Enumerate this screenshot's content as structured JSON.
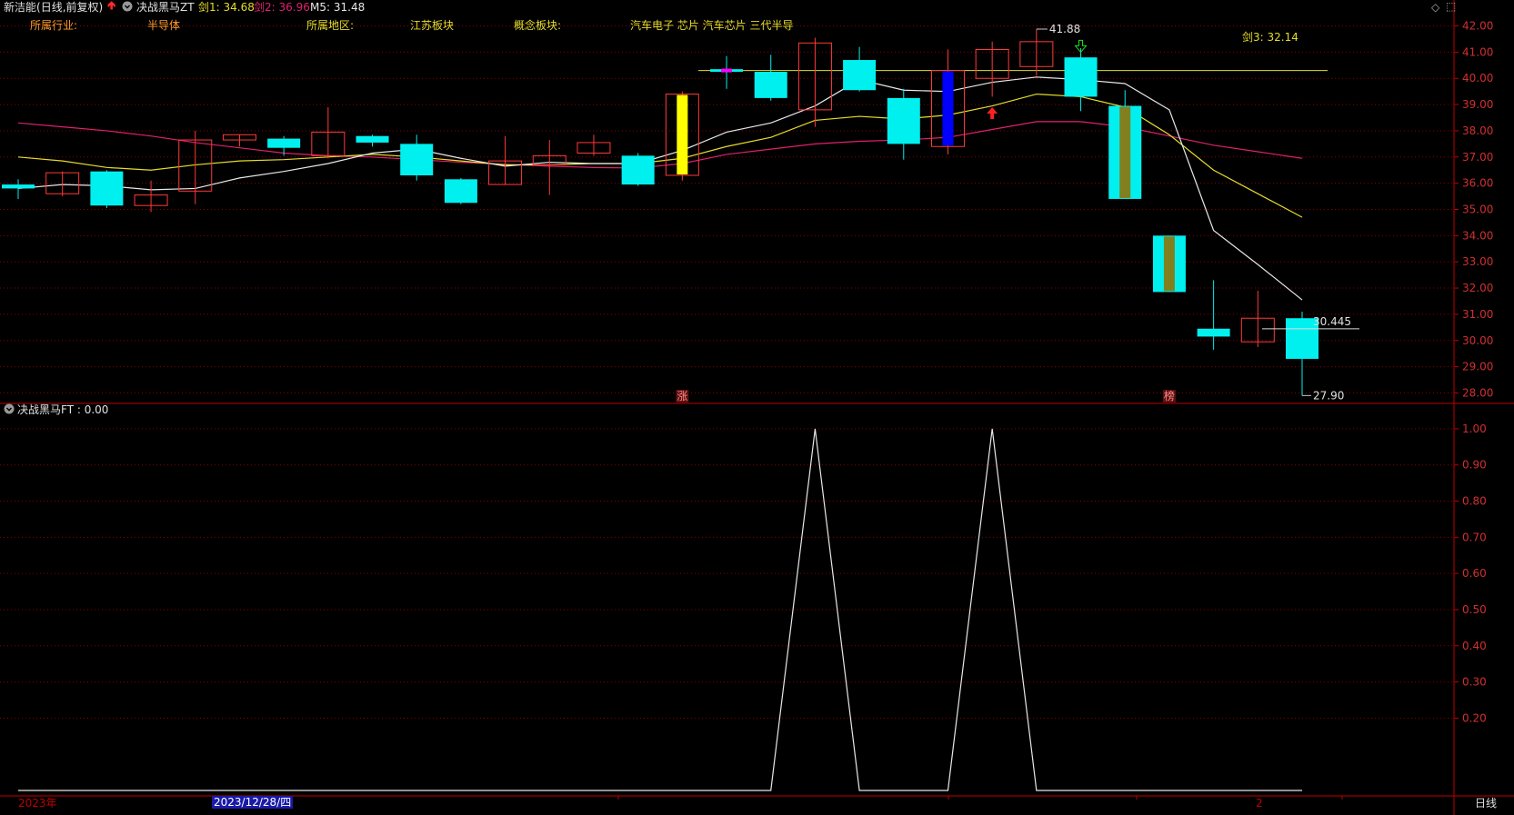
{
  "header": {
    "stock_name": "新洁能",
    "period_label": "(日线,前复权)",
    "indicator_name": "决战黑马ZT",
    "jian1_label": "剑1:",
    "jian1_value": "34.68",
    "jian2_label": "剑2:",
    "jian2_value": "36.96",
    "m5_label": "M5:",
    "m5_value": "31.48"
  },
  "info_row": {
    "industry_label": "所属行业:",
    "industry_value": "半导体",
    "region_label": "所属地区:",
    "region_value": "江苏板块",
    "concept_label": "概念板块:",
    "concept_value": "汽车电子 芯片 汽车芯片 三代半导"
  },
  "jian3": {
    "label": "剑3:",
    "value": "32.14"
  },
  "lower_panel": {
    "indicator_label": "决战黑马FT : 0.00"
  },
  "bottom_bar": {
    "year_label": "2023年",
    "date_label": "2023/12/28/四",
    "tick_label": "2",
    "period_button": "日线"
  },
  "colors": {
    "up": "#ff3a3a",
    "down": "#00f0f0",
    "ma_white": "#e8e8e8",
    "ma_yellow": "#e6dc2a",
    "ma_pink": "#e0206e",
    "grid_red": "#8a0000",
    "axis_red": "#c00000"
  },
  "chart_data": {
    "type": "candlestick",
    "y_axis_ticks": [
      "42.00",
      "41.00",
      "40.00",
      "39.00",
      "38.00",
      "37.00",
      "36.00",
      "35.00",
      "34.00",
      "33.00",
      "32.00",
      "31.00",
      "30.00",
      "29.00",
      "28.00"
    ],
    "ylim": [
      27.6,
      42.4
    ],
    "candles": [
      {
        "o": 35.95,
        "h": 36.15,
        "l": 35.4,
        "c": 35.8
      },
      {
        "o": 35.6,
        "h": 36.45,
        "l": 35.5,
        "c": 36.4
      },
      {
        "o": 36.45,
        "h": 36.5,
        "l": 35.05,
        "c": 35.15
      },
      {
        "o": 35.15,
        "h": 36.1,
        "l": 34.9,
        "c": 35.55
      },
      {
        "o": 35.7,
        "h": 38.0,
        "l": 35.2,
        "c": 37.65
      },
      {
        "o": 37.65,
        "h": 37.85,
        "l": 37.4,
        "c": 37.85
      },
      {
        "o": 37.7,
        "h": 37.8,
        "l": 37.05,
        "c": 37.35
      },
      {
        "o": 37.05,
        "h": 38.9,
        "l": 36.95,
        "c": 37.95
      },
      {
        "o": 37.8,
        "h": 37.85,
        "l": 37.4,
        "c": 37.55
      },
      {
        "o": 37.5,
        "h": 37.85,
        "l": 36.1,
        "c": 36.3
      },
      {
        "o": 36.15,
        "h": 36.2,
        "l": 35.2,
        "c": 35.25
      },
      {
        "o": 35.95,
        "h": 37.8,
        "l": 35.95,
        "c": 36.85
      },
      {
        "o": 36.7,
        "h": 37.65,
        "l": 35.55,
        "c": 37.05
      },
      {
        "o": 37.15,
        "h": 37.85,
        "l": 37.05,
        "c": 37.55
      },
      {
        "o": 37.05,
        "h": 37.15,
        "l": 35.9,
        "c": 35.95
      },
      {
        "o": 36.3,
        "h": 39.5,
        "l": 36.1,
        "c": 39.4
      },
      {
        "o": 40.35,
        "h": 40.85,
        "l": 39.6,
        "c": 40.25
      },
      {
        "o": 40.25,
        "h": 40.9,
        "l": 39.15,
        "c": 39.25
      },
      {
        "o": 38.8,
        "h": 41.55,
        "l": 38.15,
        "c": 41.35
      },
      {
        "o": 40.7,
        "h": 41.2,
        "l": 39.5,
        "c": 39.55
      },
      {
        "o": 39.25,
        "h": 39.6,
        "l": 36.9,
        "c": 37.5
      },
      {
        "o": 37.4,
        "h": 41.1,
        "l": 37.1,
        "c": 40.3
      },
      {
        "o": 40.0,
        "h": 41.4,
        "l": 39.3,
        "c": 41.1
      },
      {
        "o": 40.45,
        "h": 41.88,
        "l": 40.1,
        "c": 41.4
      },
      {
        "o": 40.8,
        "h": 41.15,
        "l": 38.75,
        "c": 39.3
      },
      {
        "o": 38.95,
        "h": 39.55,
        "l": 35.4,
        "c": 35.4
      },
      {
        "o": 34.0,
        "h": 34.0,
        "l": 31.85,
        "c": 31.85
      },
      {
        "o": 30.45,
        "h": 32.3,
        "l": 29.65,
        "c": 30.15
      },
      {
        "o": 29.95,
        "h": 31.9,
        "l": 29.75,
        "c": 30.85
      },
      {
        "o": 30.85,
        "h": 31.1,
        "l": 27.9,
        "c": 29.3
      }
    ],
    "ma_white": [
      35.8,
      35.95,
      35.9,
      35.75,
      35.8,
      36.2,
      36.45,
      36.75,
      37.15,
      37.3,
      36.95,
      36.65,
      36.8,
      36.75,
      36.75,
      37.25,
      37.95,
      38.3,
      38.95,
      39.95,
      39.55,
      39.5,
      39.85,
      40.05,
      39.95,
      39.8,
      38.8,
      34.2,
      32.9,
      31.55
    ],
    "ma_yellow": [
      37.0,
      36.85,
      36.6,
      36.5,
      36.7,
      36.85,
      36.9,
      37.0,
      37.1,
      37.0,
      36.85,
      36.7,
      36.7,
      36.75,
      36.75,
      36.95,
      37.4,
      37.75,
      38.4,
      38.55,
      38.45,
      38.6,
      38.95,
      39.4,
      39.3,
      38.9,
      37.85,
      36.5,
      35.6,
      34.7
    ],
    "ma_pink": [
      38.3,
      38.15,
      38.0,
      37.8,
      37.55,
      37.35,
      37.15,
      37.05,
      37.0,
      36.9,
      36.8,
      36.72,
      36.65,
      36.6,
      36.58,
      36.75,
      37.1,
      37.3,
      37.5,
      37.6,
      37.65,
      37.75,
      38.05,
      38.35,
      38.35,
      38.15,
      37.8,
      37.45,
      37.2,
      36.95
    ],
    "level_line": 40.3,
    "current_price_label": "30.445",
    "high_label": "41.88",
    "low_label": "27.90",
    "bottom_markers": [
      "涨",
      "榜"
    ],
    "lower": {
      "y_axis_ticks": [
        "1.00",
        "0.90",
        "0.80",
        "0.70",
        "0.60",
        "0.50",
        "0.40",
        "0.30",
        "0.20"
      ],
      "ylim": [
        0,
        1.05
      ],
      "values": [
        0,
        0,
        0,
        0,
        0,
        0,
        0,
        0,
        0,
        0,
        0,
        0,
        0,
        0,
        0,
        0,
        0,
        0,
        1,
        0,
        0,
        0,
        1,
        0,
        0,
        0,
        0,
        0,
        0,
        0
      ]
    }
  }
}
